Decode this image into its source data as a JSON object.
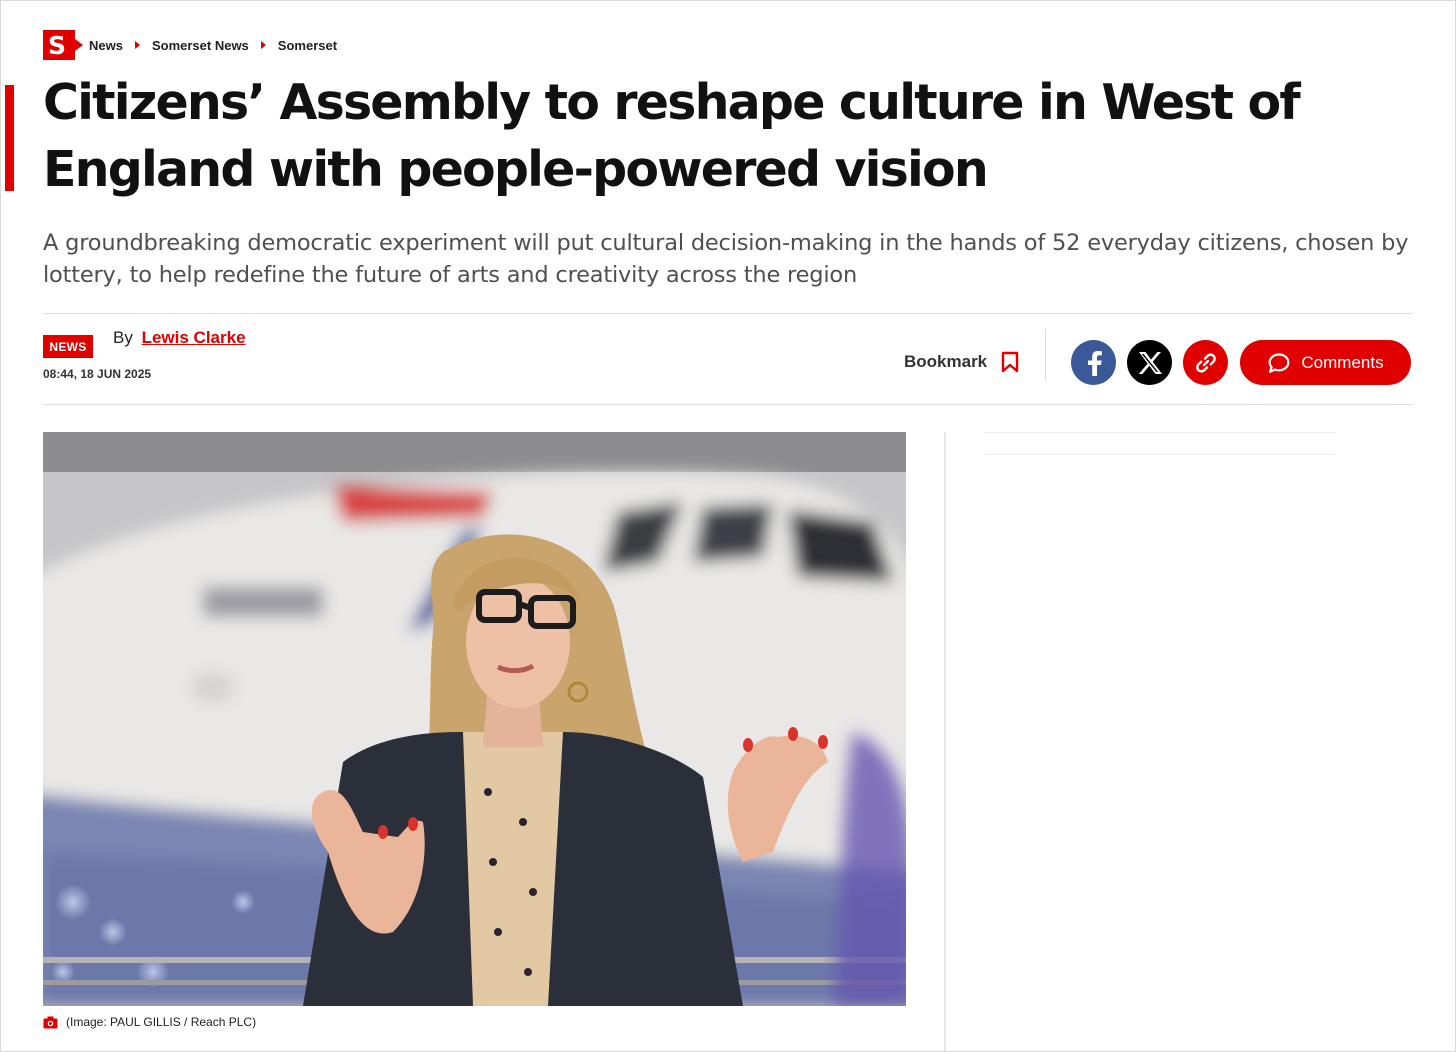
{
  "breadcrumb": {
    "logo_letter": "S",
    "items": [
      "News",
      "Somerset News",
      "Somerset"
    ]
  },
  "article": {
    "headline": "Citizens’ Assembly to reshape culture in West of England with people-powered vision",
    "standfirst": "A groundbreaking democratic experiment will put cultural decision-making in the hands of 52 everyday citizens, chosen by lottery, to help redefine the future of arts and creativity across the region",
    "category_badge": "NEWS",
    "byline_prefix": "By",
    "author": "Lewis Clarke",
    "timestamp": "08:44, 18 JUN 2025"
  },
  "actions": {
    "bookmark_label": "Bookmark",
    "comments_label": "Comments",
    "share_icons": [
      "facebook-icon",
      "x-icon",
      "link-icon"
    ]
  },
  "image": {
    "caption": "(Image: PAUL GILLIS / Reach PLC)"
  },
  "colors": {
    "brand_red": "#e00000",
    "facebook_blue": "#3b5998",
    "x_black": "#000000",
    "text_dark": "#111111",
    "text_grey": "#505050"
  }
}
